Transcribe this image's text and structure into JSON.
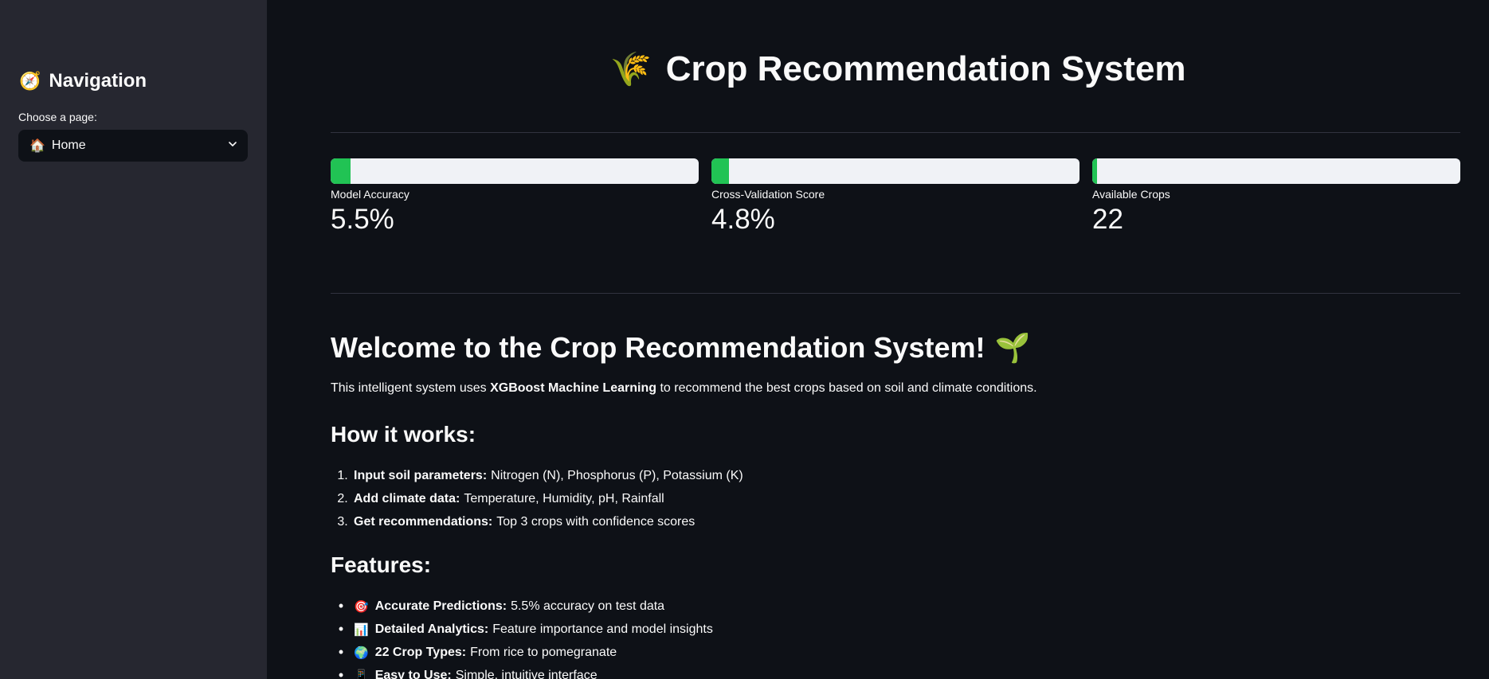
{
  "sidebar": {
    "title_icon": "🧭",
    "title": "Navigation",
    "select_label": "Choose a page:",
    "selected_icon": "🏠",
    "selected_value": "Home"
  },
  "header": {
    "icon": "🌾",
    "title": "Crop Recommendation System"
  },
  "metrics": [
    {
      "label": "Model Accuracy",
      "value": "5.5%",
      "progress": 0.055
    },
    {
      "label": "Cross-Validation Score",
      "value": "4.8%",
      "progress": 0.048
    },
    {
      "label": "Available Crops",
      "value": "22",
      "progress": 0.01
    }
  ],
  "welcome": {
    "title": "Welcome to the Crop Recommendation System!",
    "icon": "🌱",
    "intro_pre": "This intelligent system uses ",
    "intro_bold": "XGBoost Machine Learning",
    "intro_post": " to recommend the best crops based on soil and climate conditions."
  },
  "how_it_works": {
    "title": "How it works:",
    "steps": [
      {
        "num": "1.",
        "bold": "Input soil parameters:",
        "text": "Nitrogen (N), Phosphorus (P), Potassium (K)"
      },
      {
        "num": "2.",
        "bold": "Add climate data:",
        "text": "Temperature, Humidity, pH, Rainfall"
      },
      {
        "num": "3.",
        "bold": "Get recommendations:",
        "text": "Top 3 crops with confidence scores"
      }
    ]
  },
  "features": {
    "title": "Features:",
    "items": [
      {
        "icon": "🎯",
        "bold": "Accurate Predictions:",
        "text": "5.5% accuracy on test data"
      },
      {
        "icon": "📊",
        "bold": "Detailed Analytics:",
        "text": "Feature importance and model insights"
      },
      {
        "icon": "🌍",
        "bold": "22 Crop Types:",
        "text": "From rice to pomegranate"
      },
      {
        "icon": "📱",
        "bold": "Easy to Use:",
        "text": "Simple, intuitive interface"
      }
    ]
  },
  "colors": {
    "background": "#0e1117",
    "sidebar": "#262730",
    "progress_fill": "#21c354",
    "progress_track": "#f0f2f6"
  }
}
